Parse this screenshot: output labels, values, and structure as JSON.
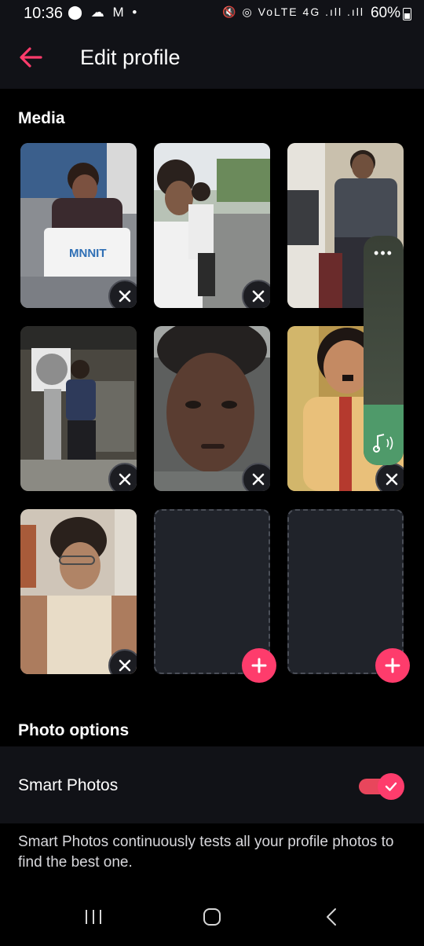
{
  "status_bar": {
    "time": "10:36",
    "left_icons": "⬤ ☁ M •",
    "right_icons": "🔇 ◎ VoLTE 4G .ıll .ıll",
    "battery": "60%"
  },
  "header": {
    "title": "Edit profile",
    "back_icon": "arrow-left-icon",
    "accent": "#fe3c6c"
  },
  "media": {
    "title": "Media",
    "tiles": [
      {
        "type": "photo",
        "action": "remove"
      },
      {
        "type": "photo",
        "action": "remove"
      },
      {
        "type": "photo",
        "action": "remove"
      },
      {
        "type": "photo",
        "action": "remove"
      },
      {
        "type": "photo",
        "action": "remove"
      },
      {
        "type": "photo",
        "action": "remove"
      },
      {
        "type": "photo",
        "action": "remove"
      },
      {
        "type": "empty",
        "action": "add"
      },
      {
        "type": "empty",
        "action": "add"
      }
    ]
  },
  "photo_options": {
    "title": "Photo options",
    "smart_photos": {
      "label": "Smart Photos",
      "enabled": true
    },
    "description": "Smart Photos continuously tests all your profile photos to find the best one."
  },
  "floating_widget": {
    "menu_icon": "more-dots-icon",
    "audio_icon": "music-note-icon"
  },
  "nav_bar": {
    "recents_icon": "recents-icon",
    "home_icon": "home-icon",
    "back_icon": "nav-back-icon"
  }
}
